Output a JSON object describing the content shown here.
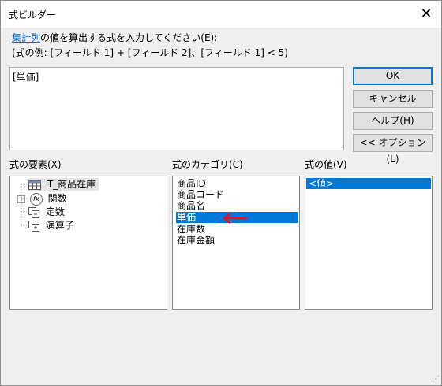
{
  "window": {
    "title": "式ビルダー",
    "close_glyph": "✕"
  },
  "description": {
    "link_text": "集計列",
    "line1_rest": "の値を算出する式を入力してください(E):",
    "line2": "(式の例: [フィールド 1] + [フィールド 2]、[フィールド 1] < 5)"
  },
  "expression": {
    "value": "[単価]"
  },
  "buttons": {
    "ok": "OK",
    "cancel": "キャンセル",
    "help": "ヘルプ(H)",
    "options": "<< オプション(L)"
  },
  "elements_panel": {
    "label": "式の要素(X)",
    "items": [
      "T_商品在庫",
      "関数",
      "定数",
      "演算子"
    ],
    "expand_glyph": "+",
    "function_glyph": "fx"
  },
  "categories_panel": {
    "label": "式のカテゴリ(C)",
    "items": [
      "商品ID",
      "商品コード",
      "商品名",
      "単価",
      "在庫数",
      "在庫金額"
    ],
    "selected": "単価"
  },
  "values_panel": {
    "label": "式の値(V)",
    "items": [
      "<値>"
    ]
  },
  "colors": {
    "selection": "#0078d7",
    "link": "#0066cc",
    "arrow": "#e81123"
  }
}
